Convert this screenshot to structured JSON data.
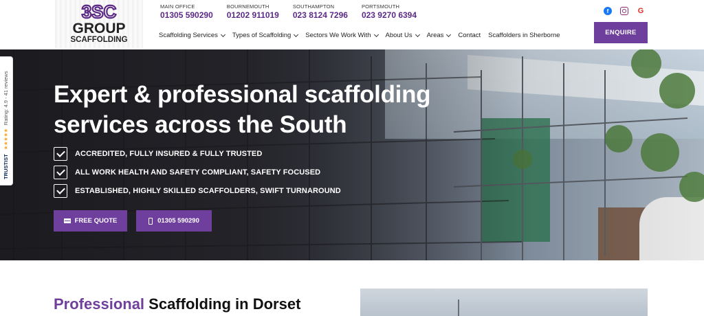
{
  "brand": {
    "logo_top": "3SC",
    "logo_mid": "GROUP",
    "logo_bottom": "SCAFFOLDING"
  },
  "phones": [
    {
      "label": "MAIN OFFICE",
      "number": "01305 590290"
    },
    {
      "label": "BOURNEMOUTH",
      "number": "01202 911019"
    },
    {
      "label": "SOUTHAMPTON",
      "number": "023 8124 7296"
    },
    {
      "label": "PORTSMOUTH",
      "number": "023 9270 6394"
    }
  ],
  "nav": [
    {
      "label": "Scaffolding Services",
      "dropdown": true
    },
    {
      "label": "Types of Scaffolding",
      "dropdown": true
    },
    {
      "label": "Sectors We Work With",
      "dropdown": true
    },
    {
      "label": "About Us",
      "dropdown": true
    },
    {
      "label": "Areas",
      "dropdown": true
    },
    {
      "label": "Contact",
      "dropdown": false
    },
    {
      "label": "Scaffolders in Sherborne",
      "dropdown": false
    }
  ],
  "social": {
    "facebook_glyph": "f",
    "google_glyph": "G",
    "icons": [
      "facebook-icon",
      "instagram-icon",
      "google-icon"
    ]
  },
  "enquire_label": "ENQUIRE",
  "hero": {
    "title_line1": "Expert & professional scaffolding",
    "title_line2": "services across the South",
    "bullets": [
      "ACCREDITED, FULLY INSURED & FULLY TRUSTED",
      "ALL WORK HEALTH AND SAFETY COMPLIANT, SAFETY FOCUSED",
      "ESTABLISHED, HIGHLY SKILLED SCAFFOLDERS, SWIFT TURNAROUND"
    ],
    "btn_quote": "FREE QUOTE",
    "btn_call": "01305 590290"
  },
  "trustist": {
    "brand": "TRUSTIST",
    "stars": "★★★★★",
    "rating_text": "Rating: 4.9 - 41 reviews"
  },
  "section": {
    "title_accent": "Professional",
    "title_rest": " Scaffolding in Dorset"
  },
  "colors": {
    "brand_purple": "#6f3f9e",
    "phone_purple": "#5b2a86",
    "star_gold": "#f5a623"
  }
}
